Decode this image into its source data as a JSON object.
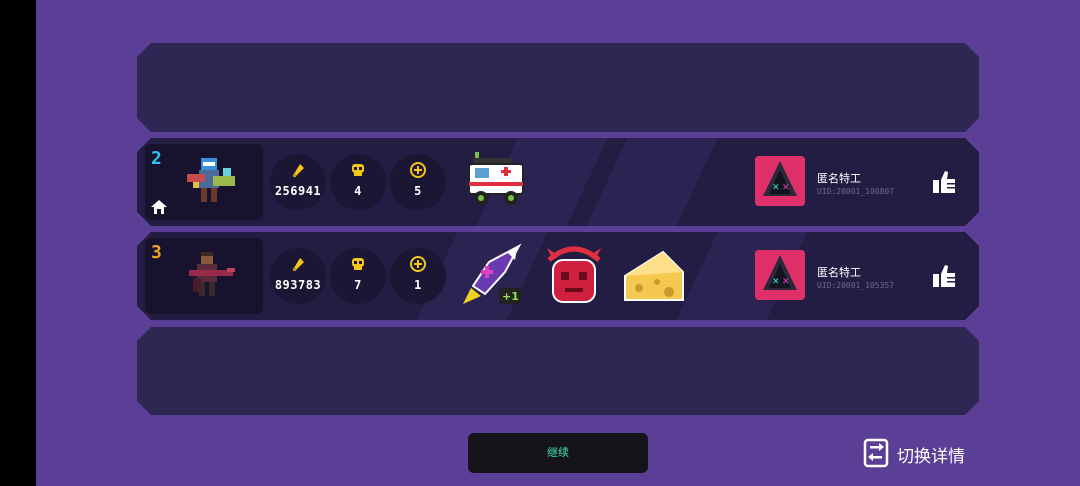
{
  "colors": {
    "background": "#5b3f96",
    "panel": "#2b2450",
    "row": "#231d44",
    "rank_2": "#2ec0f0",
    "rank_3": "#f0a020",
    "continue_text": "#3fe0b0"
  },
  "rows": [
    {
      "rank": "2",
      "is_host": true,
      "character_icon": "robot-gunner-icon",
      "stats": {
        "ammo": "256941",
        "kills": "4",
        "health": "5"
      },
      "items": [
        "ambulance-car-icon"
      ],
      "player": {
        "name": "匿名特工",
        "uid": "UID:20001_100807",
        "avatar_icon": "hooded-agent-icon"
      }
    },
    {
      "rank": "3",
      "is_host": false,
      "character_icon": "gunman-icon",
      "stats": {
        "ammo": "893783",
        "kills": "7",
        "health": "1"
      },
      "items": [
        "purple-rocket-plus-one-icon",
        "red-demon-icon",
        "cheese-icon"
      ],
      "player": {
        "name": "匿名特工",
        "uid": "UID:20001_105357",
        "avatar_icon": "hooded-agent-icon"
      }
    }
  ],
  "continue_label": "继续",
  "switch_label": "切换详情"
}
